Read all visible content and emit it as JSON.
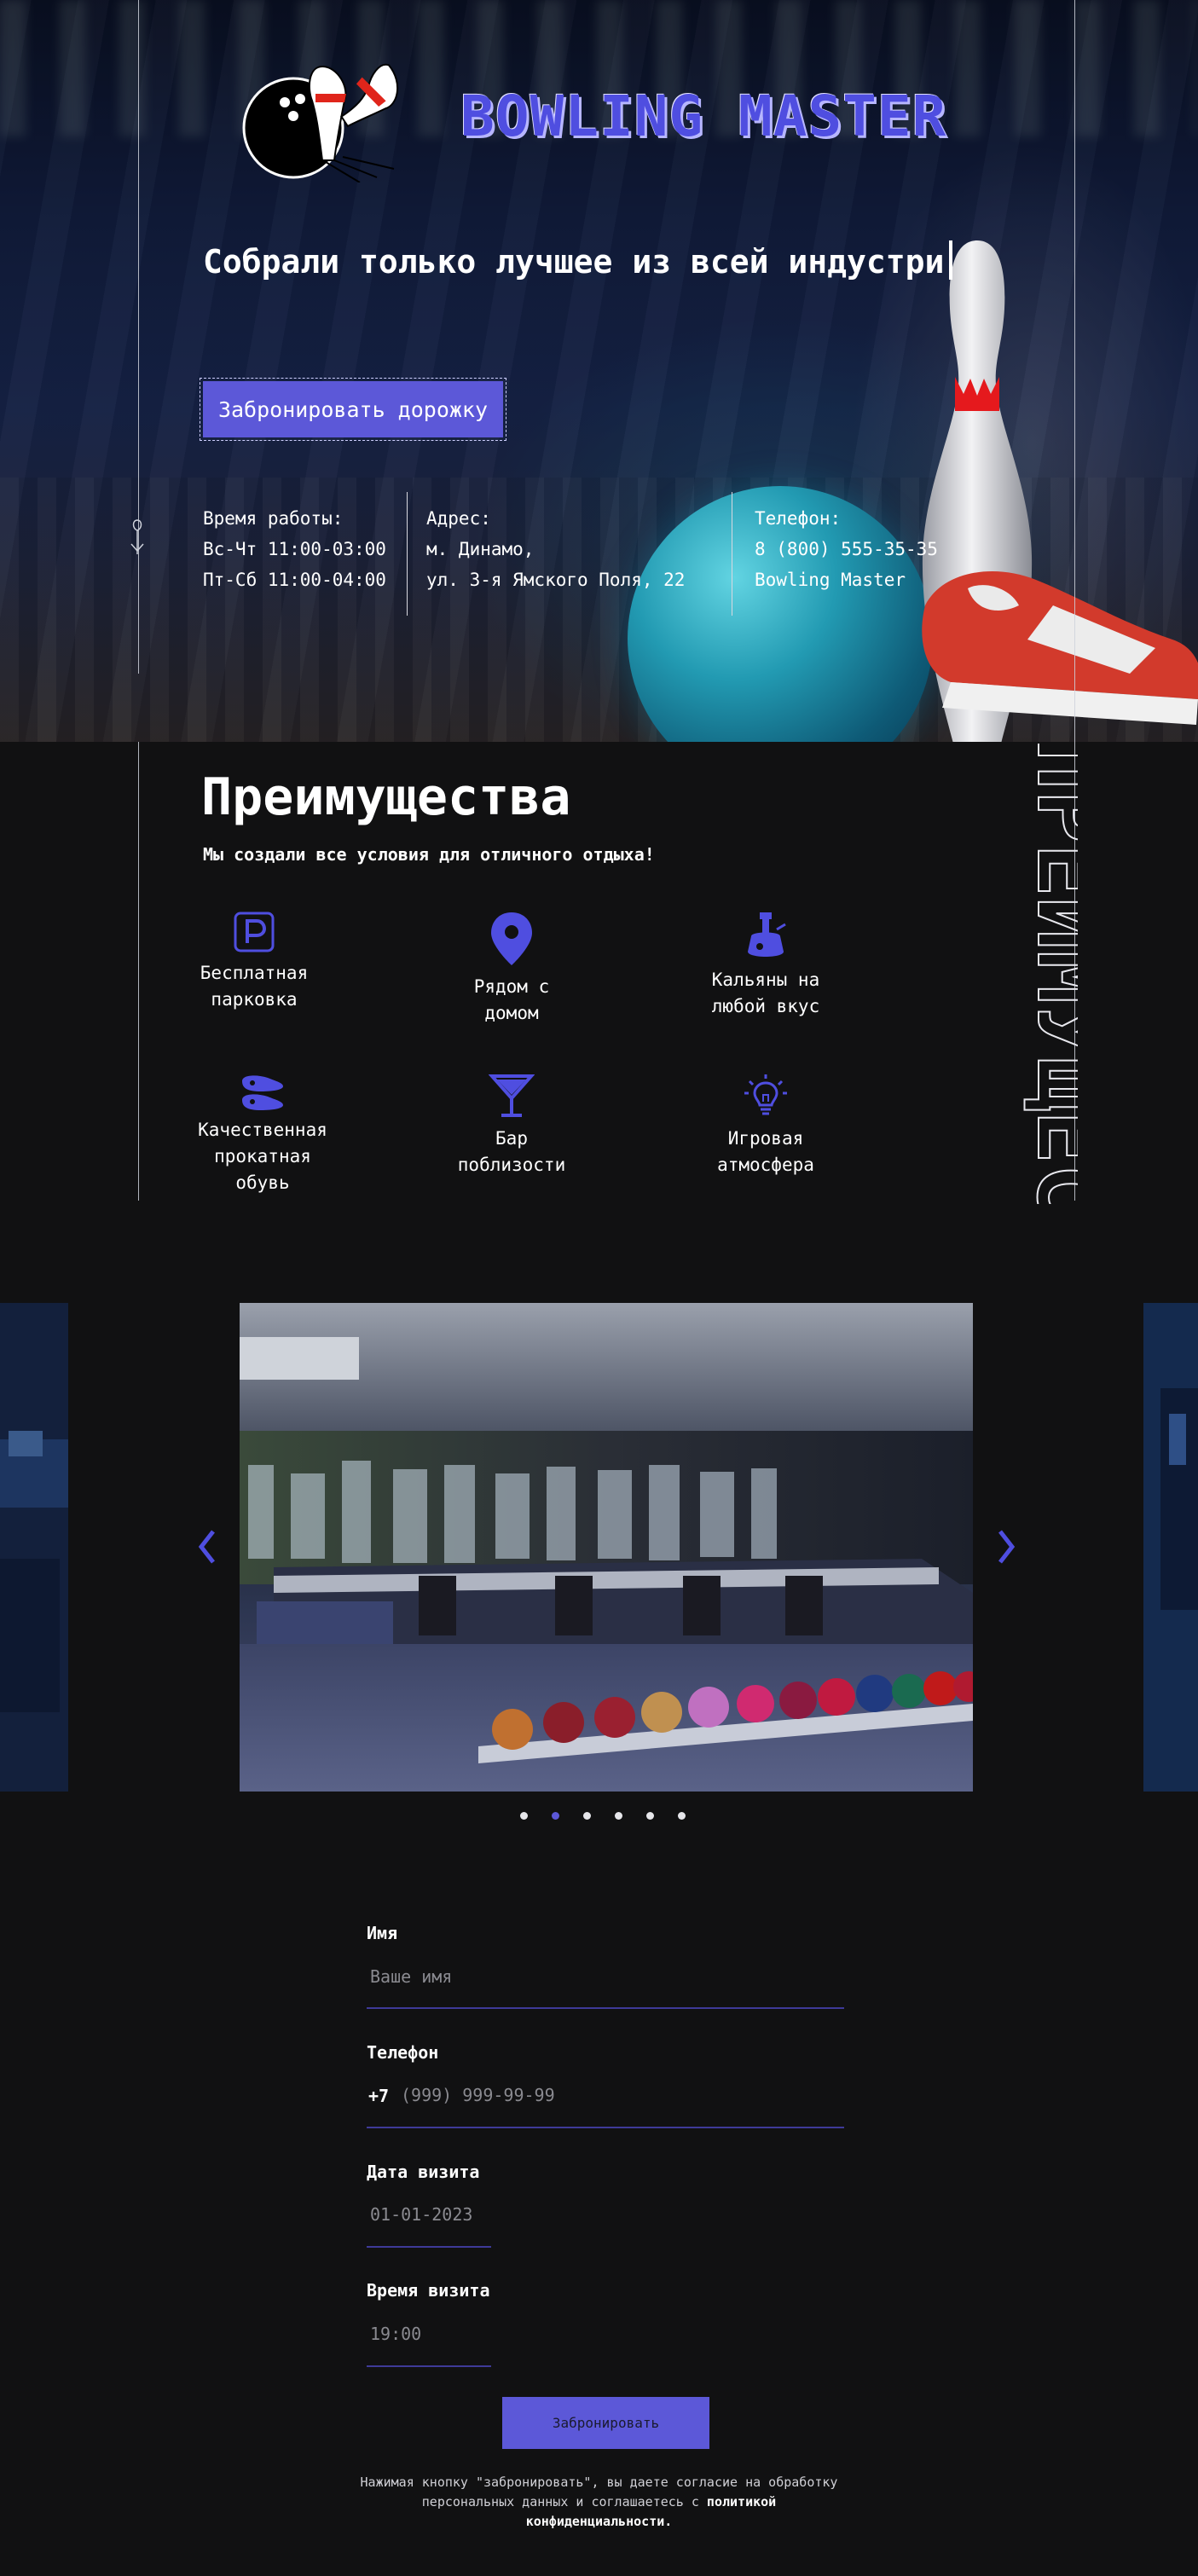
{
  "hero": {
    "brand": "BOWLING MASTER",
    "tagline": "Собрали только лучшее из всей индустри",
    "book_button": "Забронировать дорожку",
    "hours": {
      "title": "Время работы:",
      "line1": "Вс-Чт 11:00-03:00",
      "line2": "Пт-Сб 11:00-04:00"
    },
    "address": {
      "title": "Адрес:",
      "line1": "м. Динамо,",
      "line2": "ул. 3-я Ямского Поля, 22"
    },
    "phone": {
      "title": "Телефон:",
      "line1": "8 (800) 555-35-35",
      "line2": "Bowling Master"
    }
  },
  "advantages": {
    "title": "Преимущества",
    "subtitle": "Мы создали все условия для отличного отдыха!",
    "vertical_word": "ПРЕИМУЩЕС",
    "items": [
      {
        "icon": "parking-icon",
        "line1": "Бесплатная",
        "line2": "парковка",
        "line3": ""
      },
      {
        "icon": "location-pin-icon",
        "line1": "Рядом с",
        "line2": "домом",
        "line3": ""
      },
      {
        "icon": "hookah-icon",
        "line1": "Кальяны на",
        "line2": "любой вкус",
        "line3": ""
      },
      {
        "icon": "shoes-icon",
        "line1": "Качественная",
        "line2": "прокатная",
        "line3": "обувь"
      },
      {
        "icon": "cocktail-icon",
        "line1": "Бар",
        "line2": "поблизости",
        "line3": ""
      },
      {
        "icon": "lightbulb-icon",
        "line1": "Игровая",
        "line2": "атмосфера",
        "line3": ""
      }
    ],
    "accent_color": "#4f4ee0"
  },
  "slider": {
    "slide_count": 6,
    "active_index": 1
  },
  "form": {
    "name_label": "Имя",
    "name_placeholder": "Ваше имя",
    "phone_label": "Телефон",
    "phone_prefix": "+7",
    "phone_placeholder": "(999) 999-99-99",
    "date_label": "Дата визита",
    "date_placeholder": "01-01-2023",
    "time_label": "Время визита",
    "time_placeholder": "19:00",
    "submit": "Забронировать",
    "consent_text": "Нажимая кнопку \"забронировать\", вы даете согласие на обработку персональных данных и соглашаетесь с",
    "consent_link": "политикой конфиденциальности."
  },
  "colors": {
    "accent": "#5c58d8",
    "background": "#111112"
  }
}
